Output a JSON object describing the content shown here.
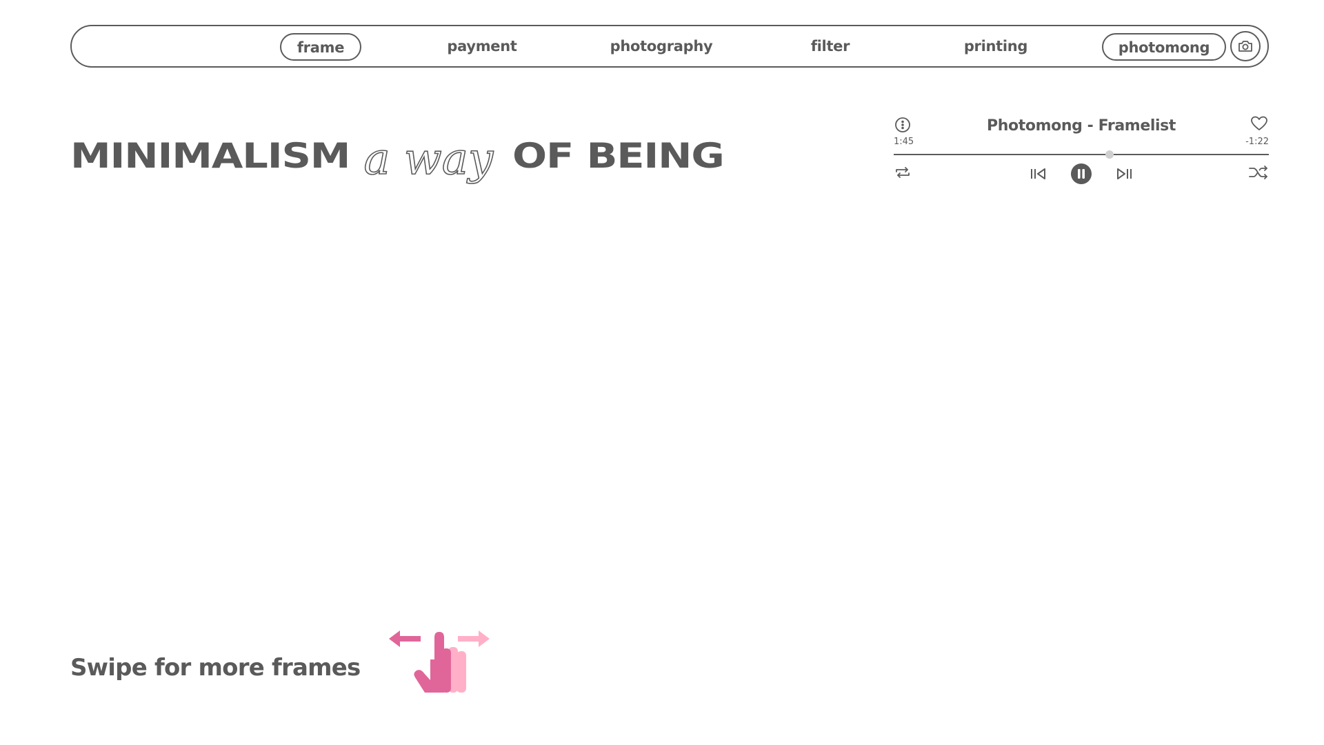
{
  "nav": {
    "items": [
      {
        "label": "frame",
        "active": true
      },
      {
        "label": "payment",
        "active": false
      },
      {
        "label": "photography",
        "active": false
      },
      {
        "label": "filter",
        "active": false
      },
      {
        "label": "printing",
        "active": false
      },
      {
        "label": "photomong",
        "active": true
      }
    ],
    "camera_icon": "camera-icon"
  },
  "headline": {
    "part1": "MINIMALISM",
    "script": "a way",
    "part2": "OF BEING"
  },
  "player": {
    "title": "Photomong - Framelist",
    "elapsed": "1:45",
    "remaining": "-1:22",
    "progress": 0.576,
    "state": "playing",
    "icons": [
      "info-icon",
      "heart-icon",
      "repeat-icon",
      "previous-icon",
      "pause-icon",
      "next-icon",
      "shuffle-icon"
    ]
  },
  "swipe": {
    "text": "Swipe for more frames",
    "icon": "swipe-hand-icon"
  },
  "colors": {
    "text": "#5a5a5a",
    "pink_dark": "#e0669a",
    "pink_light": "#ffb0c8",
    "thumb": "#cfcfcf"
  }
}
